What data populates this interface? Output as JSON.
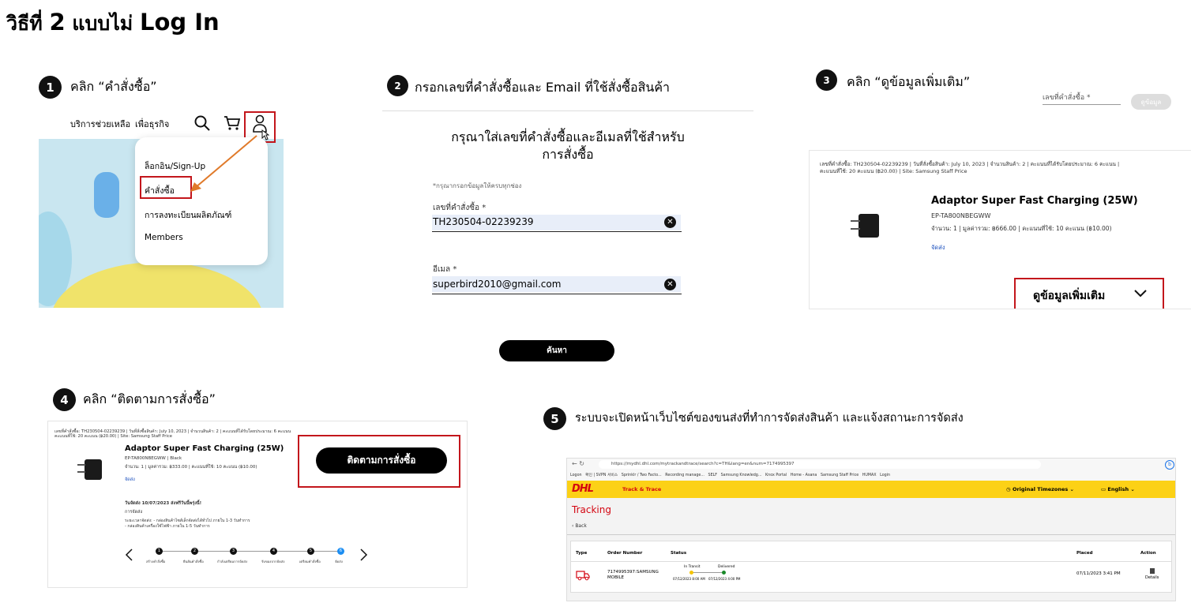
{
  "title": {
    "prefix": "วิธีที่ ",
    "num": "2",
    "mid": " แบบไม่ ",
    "login": "Log In"
  },
  "steps": {
    "s1": {
      "num": "1",
      "text": "คลิก “คำสั่งซื้อ”"
    },
    "s2": {
      "num": "2",
      "text": "กรอกเลขที่คำสั่งซื้อและ Email ที่ใช้สั่งซื้อสินค้า"
    },
    "s3": {
      "num": "3",
      "text": "คลิก “ดูข้อมูลเพิ่มเติม”"
    },
    "s4": {
      "num": "4",
      "text": "คลิก “ติดตามการสั่งซื้อ”"
    },
    "s5": {
      "num": "5",
      "text": "ระบบจะเปิดหน้าเว็บไซต์ของขนส่งที่ทำการจัดส่งสินค้า และแจ้งสถานะการจัดส่ง"
    }
  },
  "panel1": {
    "nav_support": "บริการช่วยเหลือ",
    "nav_business": "เพื่อธุรกิจ",
    "menu": [
      "ล็อกอิน/Sign-Up",
      "คำสั่งซื้อ",
      "การลงทะเบียนผลิตภัณฑ์",
      "Members"
    ]
  },
  "panel2": {
    "heading1": "กรุณาใส่เลขที่คำสั่งซื้อและอีเมลที่ใช้สำหรับ",
    "heading2": "การสั่งซื้อ",
    "required_note": "*กรุณากรอกข้อมูลให้ครบทุกช่อง",
    "order_label": "เลขที่คำสั่งซื้อ *",
    "order_value": "TH230504-02239239",
    "email_label": "อีเมล *",
    "email_value": "superbird2010@gmail.com",
    "search_button": "ค้นหา"
  },
  "panel3": {
    "order_field_placeholder": "เลขที่คำสั่งซื้อ *",
    "view_button": "ดูข้อมูล",
    "meta_line1": "เลขที่คำสั่งซื้อ: TH230504-02239239 | วันที่สั่งซื้อสินค้า: July 10, 2023 | จำนวนสินค้า: 2 | คะแนนที่ได้รับโดยประมาณ: 6 คะแนน |",
    "meta_line2": "คะแนนที่ใช้: 20 คะแนน (฿20.00) | Site: Samsung Staff Price",
    "product_name": "Adaptor Super Fast Charging (25W)",
    "sku": "EP-TA800NBEGWW",
    "qty_line": "จำนวน: 1 | มูลค่ารวม: ฿666.00 | คะแนนที่ใช้: 10 คะแนน (฿10.00)",
    "shipping_link": "จัดส่ง",
    "more_info": "ดูข้อมูลเพิ่มเติม"
  },
  "panel4": {
    "meta_line1": "เลขที่คำสั่งซื้อ: TH230504-02239239 | วันที่สั่งซื้อสินค้า: July 10, 2023 | จำนวนสินค้า: 2 | คะแนนที่ได้รับโดยประมาณ: 6 คะแนน",
    "meta_line2": "คะแนนที่ใช้: 20 คะแนน (฿20.00) | Site: Samsung Staff Price",
    "product_name": "Adaptor Super Fast Charging (25W)",
    "sku": "EP-TA800NBEGWW | Black",
    "qty_line": "จำนวน: 1 | มูลค่ารวม: ฿333.00 | คะแนนที่ใช้: 10 คะแนน (฿10.00)",
    "shipping_link": "จัดส่ง",
    "delivery_date": "วันจัดส่ง 10/07/2023 ส่งฟรีวันนี้พรุ่งนี้!",
    "delivery_method": "การจัดส่ง",
    "delivery_detail1": "ระยะเวลาจัดส่ง: - กล่องสินค้าไซส์เล็กจัดส่งได้ทั่วไป ภายใน 1-3 วันทำการ",
    "delivery_detail2": "- กล่องสินค้าเครื่องใช้ไฟฟ้า ภายใน 1-5 วันทำการ",
    "track_button": "ติดตามการสั่งซื้อ",
    "timeline": [
      {
        "num": "1",
        "label": "สร้างคำสั่งซื้อ"
      },
      {
        "num": "2",
        "label": "ยืนยันคำสั่งซื้อ"
      },
      {
        "num": "3",
        "label": "กำลังเตรียมการจัดส่ง"
      },
      {
        "num": "4",
        "label": "รับของจากจัดส่ง"
      },
      {
        "num": "5",
        "label": "เตรียมคำสั่งซื้อ"
      },
      {
        "num": "6",
        "label": "จัดส่ง"
      }
    ]
  },
  "panel5": {
    "url": "https://mydhl.dhl.com/mytrackandtrace/search?c=TH&lang=en&num=7174995397",
    "bookmarks": [
      "Logon",
      "확인 | SVPN 서비스",
      "Sprinklr / Two Facto...",
      "Recording manage...",
      "SELF",
      "Samsung Knowledg...",
      "Knox Portal",
      "Home - Asana",
      "Samsung Staff Price",
      "HUMAX",
      "Login"
    ],
    "brand": "DHL",
    "track_label": "Track & Trace",
    "timezone": "Original Timezones",
    "language": "English",
    "page_title": "Tracking",
    "back": "Back",
    "col_type": "Type",
    "col_order": "Order Number",
    "col_status": "Status",
    "col_placed": "Placed",
    "col_action": "Action",
    "order_number": "7174995397:SAMSUNG",
    "order_number2": "MOBILE",
    "status_transit": "In Transit",
    "status_delivered": "Delivered",
    "transit_time": "07/12/2023 8:00 AM",
    "delivered_time": "07/12/2023 4:00 PM",
    "placed": "07/11/2023 3:41 PM",
    "action": "Details",
    "colors": {
      "dhl_yellow": "#fcd116",
      "dhl_red": "#d40511"
    }
  }
}
